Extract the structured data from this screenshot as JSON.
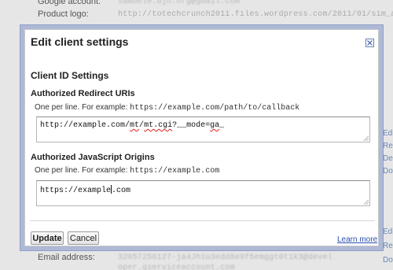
{
  "background": {
    "rows": [
      {
        "label": "Google account:",
        "value": "samuele.bjn.org@gmail.com"
      },
      {
        "label": "Product logo:",
        "value": "http://totechcrunch2011.files.wordpress.com/2011/01/sim_ap"
      },
      {
        "label": "Email address:",
        "value": "32057256127-ja4Jh1u3edd8e9f5emggt0t1k3@devel"
      }
    ],
    "email_continued": "oper.gserviceaccount.com",
    "side_links": [
      "Edi",
      "Res",
      "Del",
      "Dow",
      "Edi",
      "Res",
      "Dow"
    ]
  },
  "dialog": {
    "title": "Edit client settings",
    "close_icon": "close-x-icon",
    "section_title": "Client ID Settings",
    "redirect": {
      "label": "Authorized Redirect URIs",
      "help_prefix": "One per line. For example: ",
      "help_example": "https://example.com/path/to/callback",
      "value_parts": [
        "http://example.com/",
        "mt",
        "/",
        "mt.cgi",
        "?__mode=",
        "ga",
        "_"
      ]
    },
    "origins": {
      "label": "Authorized JavaScript Origins",
      "help_prefix": "One per line. For example: ",
      "help_example": "https://example.com",
      "value_before_caret": "https://example",
      "value_after_caret": ".com"
    },
    "buttons": {
      "update": "Update",
      "cancel": "Cancel"
    },
    "learn_more": "Learn more"
  },
  "colors": {
    "frame": "#aeb9d6",
    "link": "#2a4fb0",
    "spellcheck": "#e02020"
  }
}
